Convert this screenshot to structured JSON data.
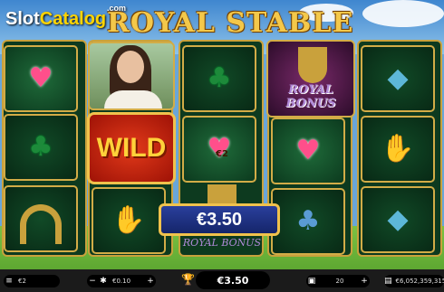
{
  "logo": {
    "brand_slot": "Slot",
    "brand_catalog": "Catalog",
    "brand_com": ".com"
  },
  "game": {
    "title": "ROYAL STABLE"
  },
  "reels": {
    "wild_label": "WILD",
    "bonus_label": "ROYAL BONUS",
    "bonus_label_2": "ROYAL BONUS",
    "cell_value": "€2"
  },
  "win": {
    "amount": "€3.50"
  },
  "controls": {
    "bet": "€2",
    "coin": "€0.10",
    "last_win": "€3.50",
    "autoplay": "20",
    "balance": "€6,052,359,315"
  },
  "icons": [
    "diamond-icon",
    "heart-icon",
    "club-icon",
    "horseshoe-icon",
    "gloves-icon",
    "trophy-icon",
    "coin-icon",
    "autoplay-icon",
    "balance-icon"
  ]
}
